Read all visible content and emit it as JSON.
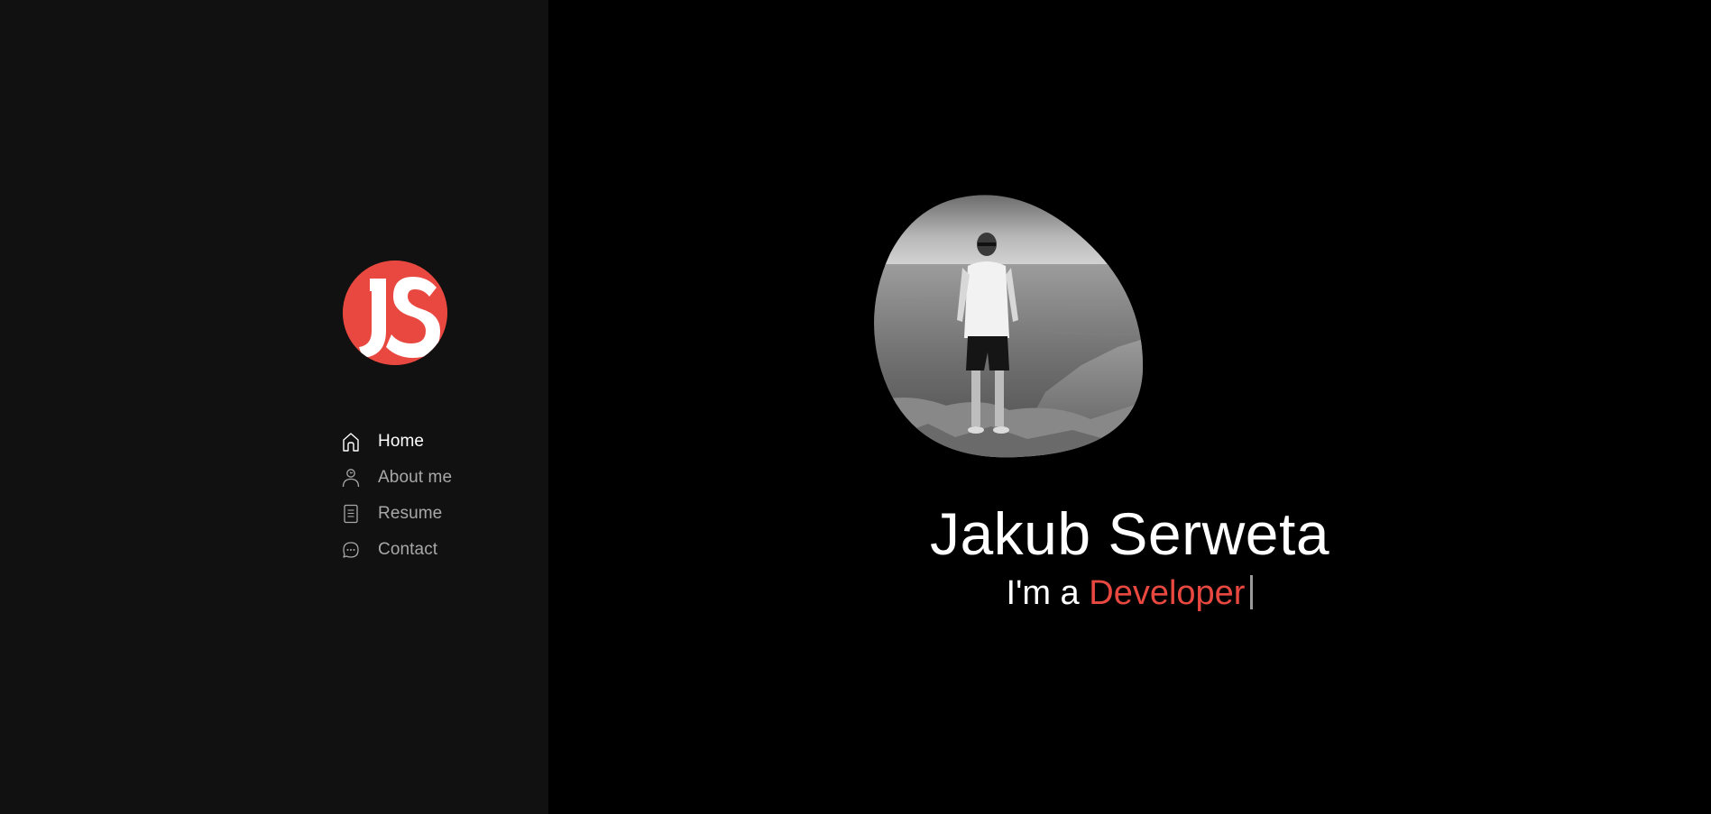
{
  "logo": {
    "initials": "JS",
    "color": "#e8483f"
  },
  "nav": {
    "items": [
      {
        "label": "Home",
        "icon": "home-icon",
        "active": true
      },
      {
        "label": "About me",
        "icon": "user-icon",
        "active": false
      },
      {
        "label": "Resume",
        "icon": "document-icon",
        "active": false
      },
      {
        "label": "Contact",
        "icon": "chat-icon",
        "active": false
      }
    ]
  },
  "hero": {
    "name": "Jakub Serweta",
    "tagline_prefix": "I'm a",
    "tagline_role": "Developer",
    "photo": "profile-photo"
  },
  "colors": {
    "accent": "#e8483f",
    "sidebar_bg": "#111111",
    "main_bg": "#000000"
  }
}
